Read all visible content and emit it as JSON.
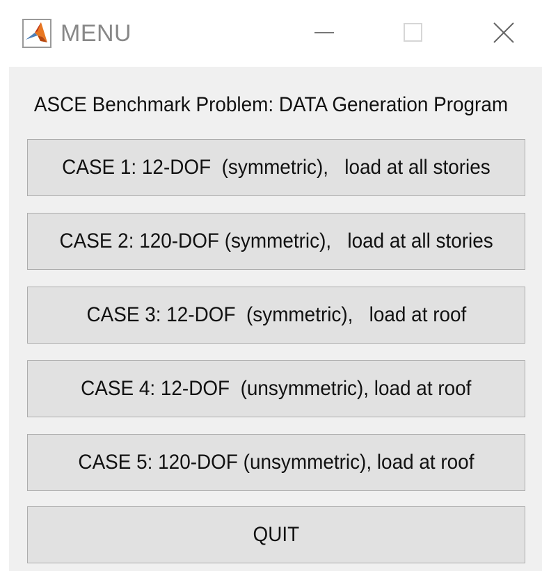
{
  "window": {
    "title": "MENU",
    "icon": "matlab-logo-icon",
    "controls": [
      "minimize-icon",
      "maximize-icon",
      "close-icon"
    ]
  },
  "heading": "ASCE Benchmark Problem: DATA Generation Program",
  "buttons": [
    {
      "label": "CASE 1: 12-DOF  (symmetric),   load at all stories"
    },
    {
      "label": "CASE 2: 120-DOF (symmetric),   load at all stories"
    },
    {
      "label": "CASE 3: 12-DOF  (symmetric),   load at roof"
    },
    {
      "label": "CASE 4: 12-DOF  (unsymmetric), load at roof"
    },
    {
      "label": "CASE 5: 120-DOF (unsymmetric), load at roof"
    },
    {
      "label": "QUIT"
    }
  ],
  "colors": {
    "client_background": "#f0f0f0",
    "button_face": "#e1e1e1",
    "button_border": "#adadad",
    "title_text": "#888888"
  }
}
